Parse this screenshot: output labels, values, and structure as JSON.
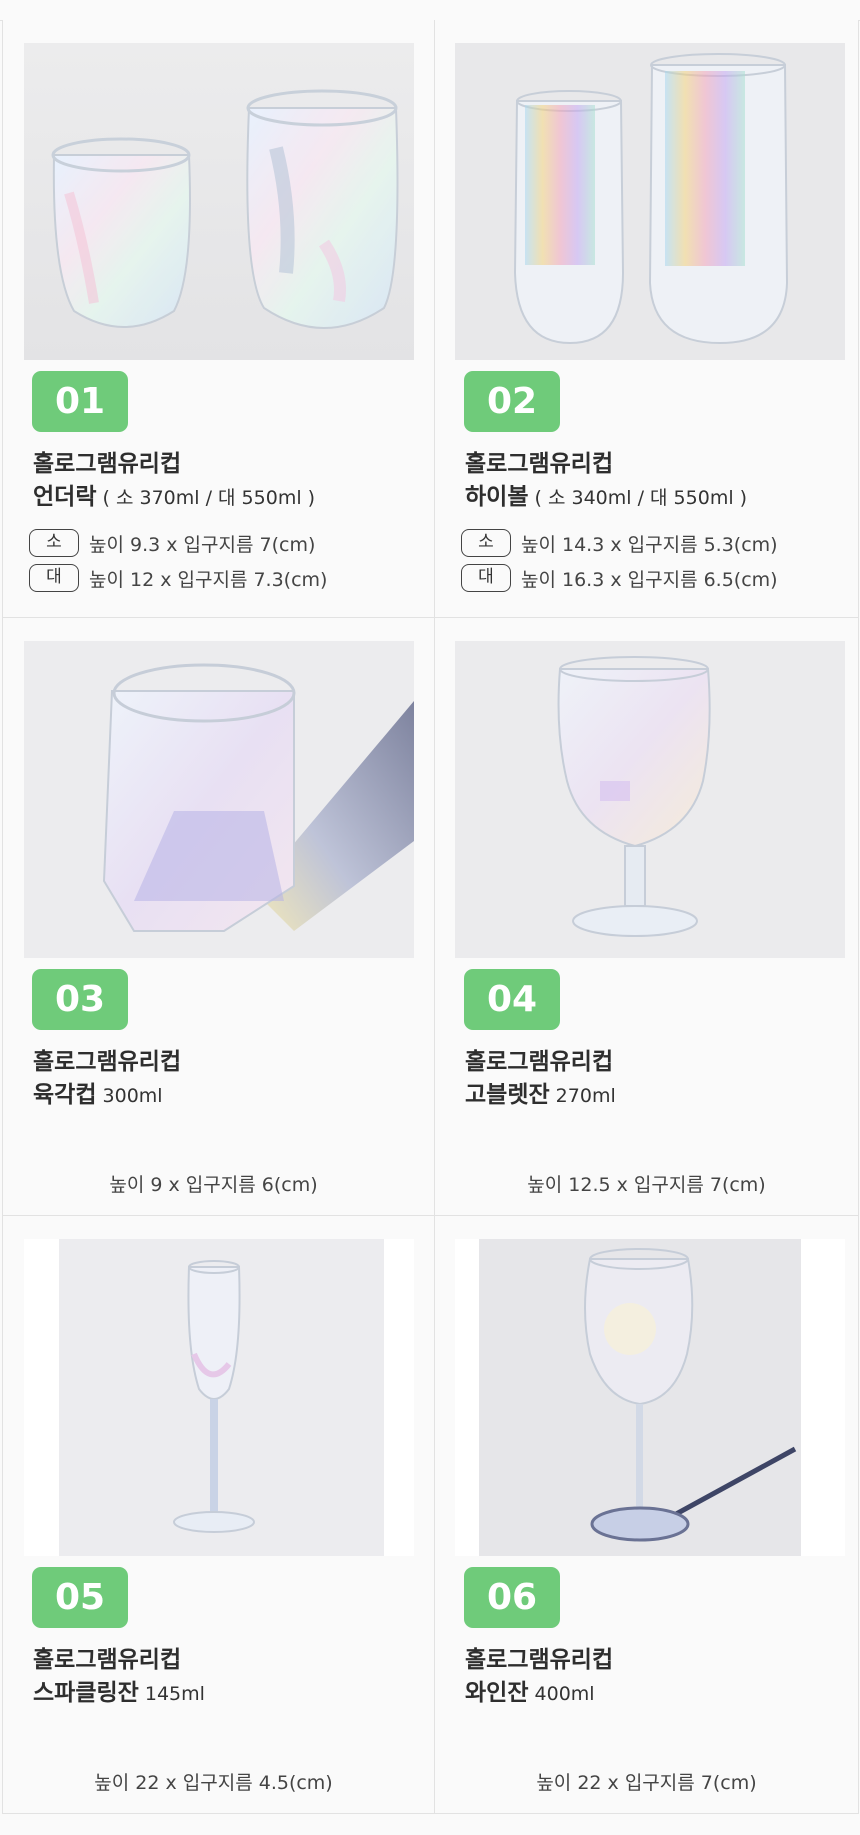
{
  "products": [
    {
      "number": "01",
      "title_line1": "홀로그램유리컵",
      "name": "언더락",
      "capacity": " ( 소 370ml / 대 550ml )",
      "specs": [
        {
          "tag": "소",
          "text": "높이 9.3 x 입구지름 7(cm)"
        },
        {
          "tag": "대",
          "text": "높이 12 x 입구지름 7.3(cm)"
        }
      ]
    },
    {
      "number": "02",
      "title_line1": "홀로그램유리컵",
      "name": "하이볼",
      "capacity": " ( 소 340ml / 대 550ml )",
      "specs": [
        {
          "tag": "소",
          "text": "높이 14.3 x 입구지름 5.3(cm)"
        },
        {
          "tag": "대",
          "text": "높이 16.3 x 입구지름 6.5(cm)"
        }
      ]
    },
    {
      "number": "03",
      "title_line1": "홀로그램유리컵",
      "name": "육각컵",
      "capacity": " 300ml",
      "spec": "높이 9 x 입구지름 6(cm)"
    },
    {
      "number": "04",
      "title_line1": "홀로그램유리컵",
      "name": "고블렛잔",
      "capacity": " 270ml",
      "spec": "높이 12.5 x 입구지름 7(cm)"
    },
    {
      "number": "05",
      "title_line1": "홀로그램유리컵",
      "name": "스파클링잔",
      "capacity": " 145ml",
      "spec": "높이 22 x 입구지름 4.5(cm)"
    },
    {
      "number": "06",
      "title_line1": "홀로그램유리컵",
      "name": "와인잔",
      "capacity": " 400ml",
      "spec": "높이 22 x 입구지름 7(cm)"
    }
  ],
  "colors": {
    "badge": "#6fcb7a",
    "background": "#fafafa",
    "photo_bg": "#e9e9ea",
    "border": "#e2e2e2"
  }
}
